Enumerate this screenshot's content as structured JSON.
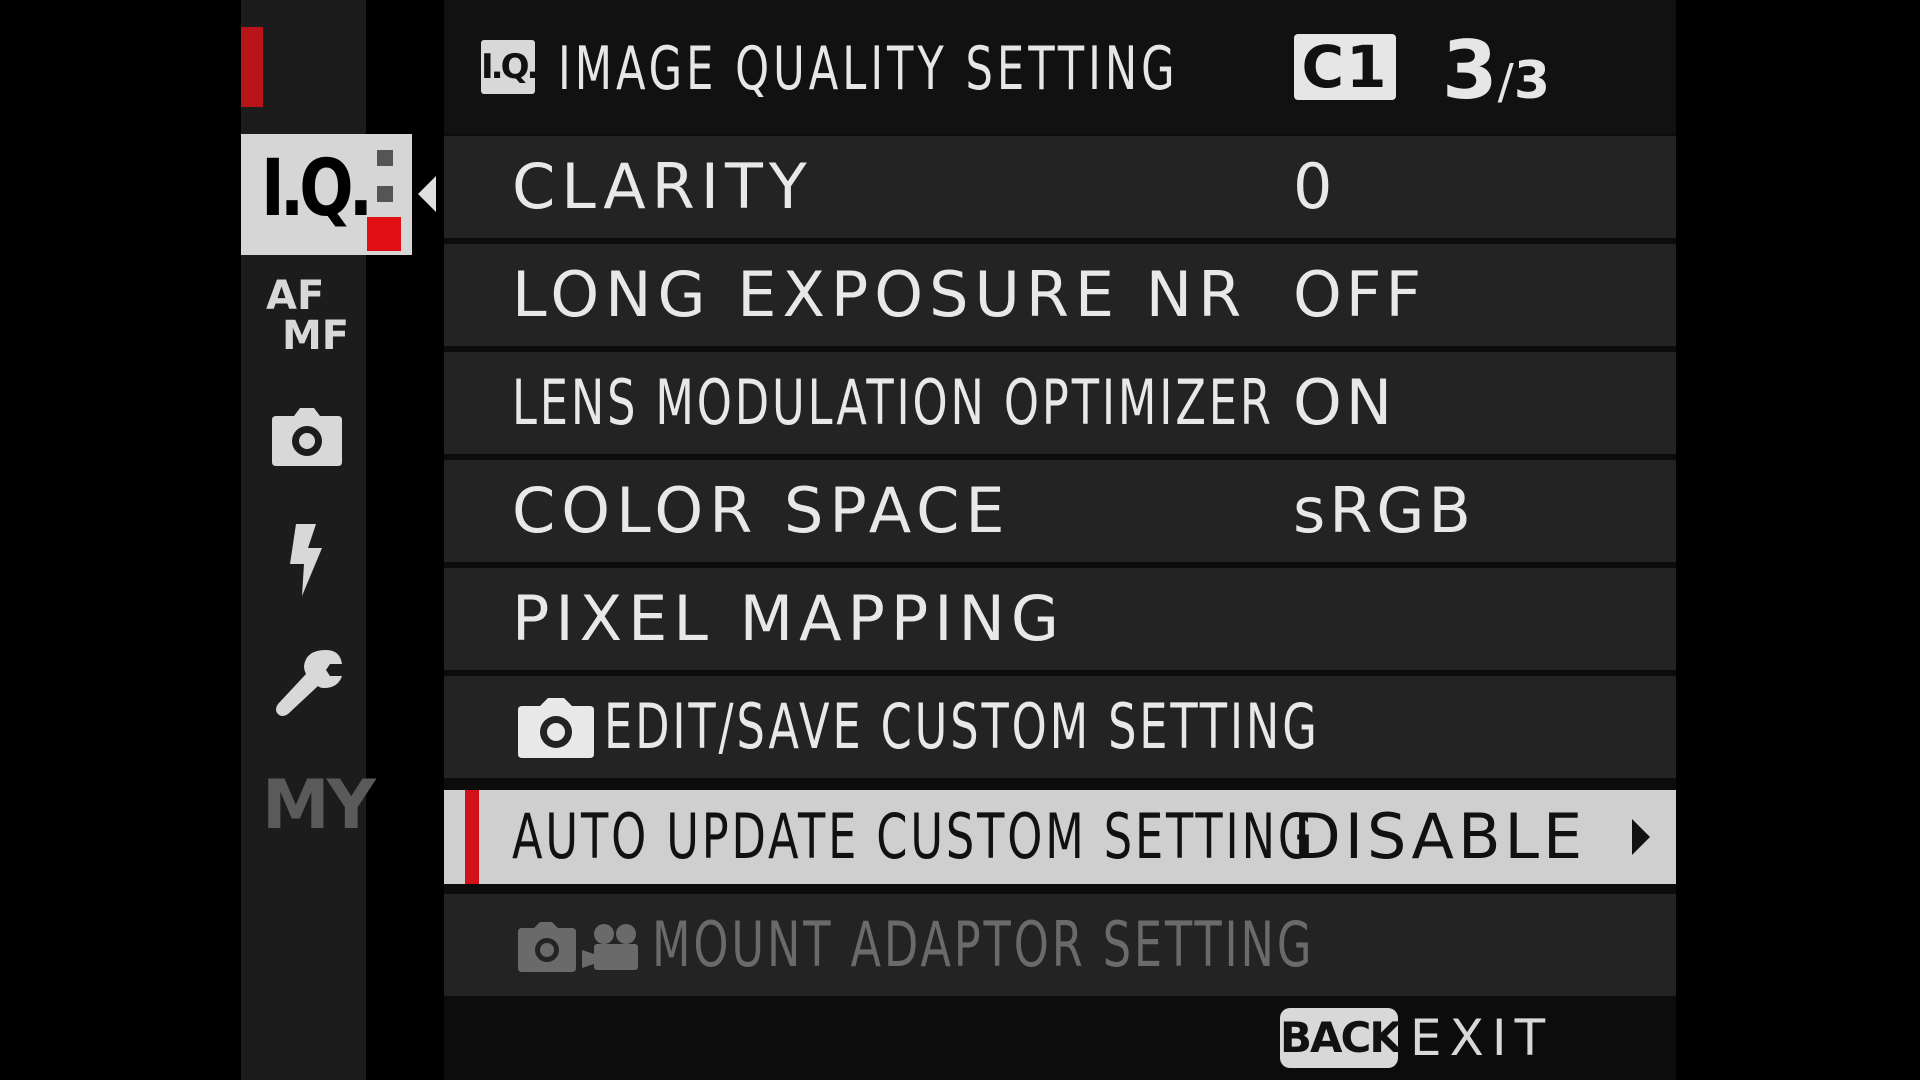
{
  "header": {
    "section_badge": "I.Q.",
    "title": "IMAGE QUALITY SETTING",
    "custom_slot": "C1",
    "page_current": "3",
    "page_separator": "/",
    "page_total": "3"
  },
  "sidebar": {
    "active_tab_label": "I.Q.",
    "tabs": [
      {
        "icon": "iq-icon",
        "active": true
      },
      {
        "icon": "af-mf-icon",
        "label_top": "AF",
        "label_bottom": "MF"
      },
      {
        "icon": "camera-icon"
      },
      {
        "icon": "flash-icon"
      },
      {
        "icon": "wrench-icon"
      },
      {
        "icon": "my-menu-icon",
        "label": "MY"
      }
    ]
  },
  "menu": {
    "items": [
      {
        "label": "CLARITY",
        "value": "0"
      },
      {
        "label": "LONG EXPOSURE NR",
        "value": "OFF"
      },
      {
        "label": "LENS MODULATION OPTIMIZER",
        "value": "ON"
      },
      {
        "label": "COLOR SPACE",
        "value": "sRGB"
      },
      {
        "label": "PIXEL MAPPING",
        "value": ""
      },
      {
        "label": "EDIT/SAVE CUSTOM SETTING",
        "value": "",
        "icon": "camera-icon"
      },
      {
        "label": "AUTO UPDATE CUSTOM SETTING",
        "value": "DISABLE",
        "selected": true
      },
      {
        "label": "MOUNT ADAPTOR SETTING",
        "value": "",
        "icon": "camera-movie-icon",
        "disabled": true
      }
    ]
  },
  "footer": {
    "back_label": "BACK",
    "exit_label": "EXIT"
  },
  "colors": {
    "accent": "#d2101a",
    "selected_row": "#cfcfcf",
    "row": "#232323",
    "text": "#e8e8e8",
    "disabled_text": "#6a6a6a"
  }
}
